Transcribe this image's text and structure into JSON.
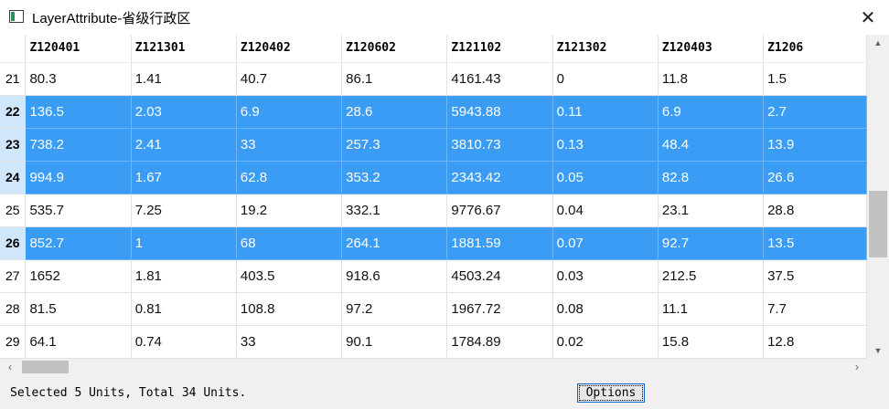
{
  "window": {
    "title": "LayerAttribute-省级行政区"
  },
  "grid": {
    "columns": [
      "Z120401",
      "Z121301",
      "Z120402",
      "Z120602",
      "Z121102",
      "Z121302",
      "Z120403",
      "Z1206"
    ],
    "rows": [
      {
        "id": "21",
        "selected": false,
        "cells": [
          "80.3",
          "1.41",
          "40.7",
          "86.1",
          "4161.43",
          "0",
          "11.8",
          "1.5"
        ]
      },
      {
        "id": "22",
        "selected": true,
        "cells": [
          "136.5",
          "2.03",
          "6.9",
          "28.6",
          "5943.88",
          "0.11",
          "6.9",
          "2.7"
        ]
      },
      {
        "id": "23",
        "selected": true,
        "cells": [
          "738.2",
          "2.41",
          "33",
          "257.3",
          "3810.73",
          "0.13",
          "48.4",
          "13.9"
        ]
      },
      {
        "id": "24",
        "selected": true,
        "cells": [
          "994.9",
          "1.67",
          "62.8",
          "353.2",
          "2343.42",
          "0.05",
          "82.8",
          "26.6"
        ]
      },
      {
        "id": "25",
        "selected": false,
        "cells": [
          "535.7",
          "7.25",
          "19.2",
          "332.1",
          "9776.67",
          "0.04",
          "23.1",
          "28.8"
        ]
      },
      {
        "id": "26",
        "selected": true,
        "cells": [
          "852.7",
          "1",
          "68",
          "264.1",
          "1881.59",
          "0.07",
          "92.7",
          "13.5"
        ]
      },
      {
        "id": "27",
        "selected": false,
        "cells": [
          "1652",
          "1.81",
          "403.5",
          "918.6",
          "4503.24",
          "0.03",
          "212.5",
          "37.5"
        ]
      },
      {
        "id": "28",
        "selected": false,
        "cells": [
          "81.5",
          "0.81",
          "108.8",
          "97.2",
          "1967.72",
          "0.08",
          "11.1",
          "7.7"
        ]
      },
      {
        "id": "29",
        "selected": false,
        "cells": [
          "64.1",
          "0.74",
          "33",
          "90.1",
          "1784.89",
          "0.02",
          "15.8",
          "12.8"
        ]
      }
    ]
  },
  "scrollbars": {
    "vertical_position": 0.62,
    "horizontal_position": 0.0
  },
  "status": {
    "text": "Selected 5 Units, Total 34 Units.",
    "options_label": "Options"
  },
  "colors": {
    "selection": "#3a9cf5",
    "selected_row_header": "#cfe6fb",
    "chrome": "#f0f0f0",
    "focus_border": "#0a66d2"
  },
  "icons": {
    "app": "window-icon",
    "close": "close-icon",
    "up": "scroll-up-arrow-icon",
    "down": "scroll-down-arrow-icon",
    "left": "scroll-left-arrow-icon",
    "right": "scroll-right-arrow-icon"
  }
}
